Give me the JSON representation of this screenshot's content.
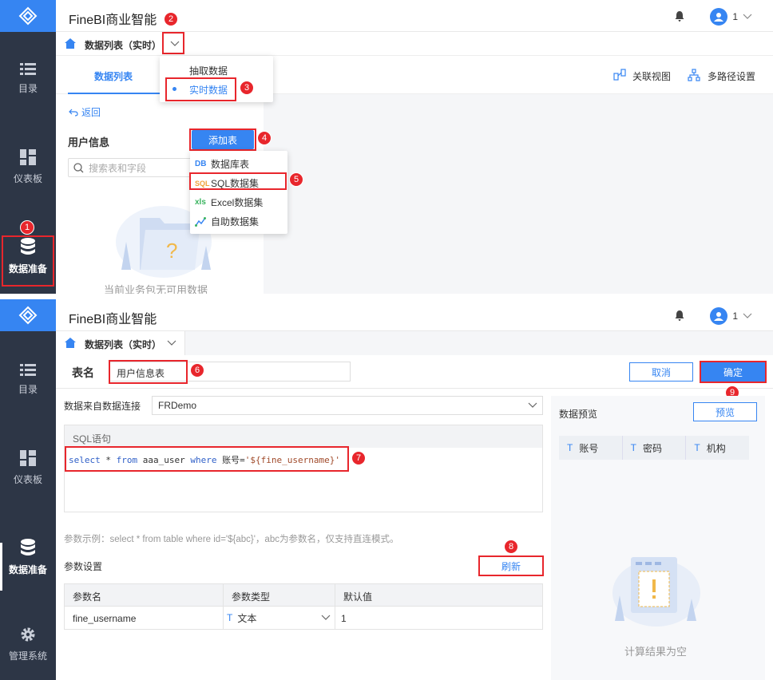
{
  "app": {
    "title": "FineBI商业智能",
    "user_name": "1"
  },
  "sidebar": {
    "catalog": "目录",
    "dashboard": "仪表板",
    "data_prep": "数据准备",
    "admin": "管理系统"
  },
  "subheader": {
    "label": "数据列表（实时）"
  },
  "panel1": {
    "tab_data_list": "数据列表",
    "mode_menu": [
      "抽取数据",
      "实时数据"
    ],
    "related_view": "关联视图",
    "multipath": "多路径设置",
    "back": "返回",
    "group_title": "用户信息",
    "add_table": "添加表",
    "search_placeholder": "搜索表和字段",
    "empty_text": "当前业务包无可用数据",
    "add_menu": [
      {
        "icon": "DB",
        "label": "数据库表"
      },
      {
        "icon": "SQL",
        "label": "SQL数据集"
      },
      {
        "icon": "xls",
        "label": "Excel数据集"
      },
      {
        "icon": "self",
        "label": "自助数据集"
      }
    ]
  },
  "panel2": {
    "table_name_label": "表名",
    "table_name_value": "用户信息表",
    "cancel": "取消",
    "confirm": "确定",
    "connection_label": "数据来自数据连接",
    "connection_value": "FRDemo",
    "sql_label": "SQL语句",
    "sql": {
      "kw1": "select",
      "star": " * ",
      "kw2": "from",
      "table": " aaa_user ",
      "kw3": "where",
      "cond": " 账号=",
      "str": "'${fine_username}'"
    },
    "param_hint": "参数示例：select * from table where id='${abc}'，abc为参数名，仅支持直连模式。",
    "param_settings": "参数设置",
    "refresh": "刷新",
    "param_headers": [
      "参数名",
      "参数类型",
      "默认值"
    ],
    "param_row": {
      "name": "fine_username",
      "type": "文本",
      "default": "1"
    },
    "preview_title": "数据预览",
    "preview_btn": "预览",
    "preview_headers": [
      "账号",
      "密码",
      "机构"
    ],
    "empty_result": "计算结果为空"
  },
  "steps": [
    "1",
    "2",
    "3",
    "4",
    "5",
    "6",
    "7",
    "8",
    "9"
  ],
  "colors": {
    "accent": "#3685f2",
    "sidebar": "#2d3646",
    "highlight": "#e8262c"
  }
}
